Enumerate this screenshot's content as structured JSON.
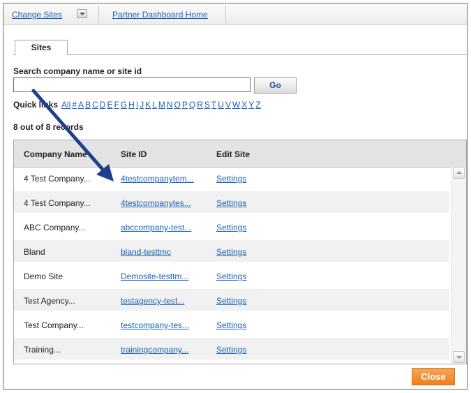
{
  "topbar": {
    "change_sites": "Change Sites",
    "partner_home": "Partner Dashboard Home"
  },
  "tab": {
    "label": "Sites"
  },
  "search": {
    "label": "Search company name or site id",
    "value": "",
    "go_label": "Go"
  },
  "quicklinks": {
    "label": "Quick links",
    "letters": [
      "All",
      "#",
      "A",
      "B",
      "C",
      "D",
      "E",
      "F",
      "G",
      "H",
      "I",
      "J",
      "K",
      "L",
      "M",
      "N",
      "O",
      "P",
      "Q",
      "R",
      "S",
      "T",
      "U",
      "V",
      "W",
      "X",
      "Y",
      "Z"
    ]
  },
  "records": {
    "text": "8 out of 8 records"
  },
  "table": {
    "headers": [
      "Company Name",
      "Site ID",
      "Edit Site"
    ],
    "rows": [
      {
        "company": "4 Test Company...",
        "site": "4testcompanytem...",
        "edit": "Settings"
      },
      {
        "company": "4 Test Company...",
        "site": "4testcompanytes...",
        "edit": "Settings"
      },
      {
        "company": "ABC Company...",
        "site": "abccompany-test...",
        "edit": "Settings"
      },
      {
        "company": "Bland",
        "site": "bland-testtmc",
        "edit": "Settings"
      },
      {
        "company": "Demo Site",
        "site": "Demosite-testtm...",
        "edit": "Settings"
      },
      {
        "company": "Test Agency...",
        "site": "testagency-test...",
        "edit": "Settings"
      },
      {
        "company": "Test Company...",
        "site": "testcompany-tes...",
        "edit": "Settings"
      },
      {
        "company": "Training...",
        "site": "trainingcompany...",
        "edit": "Settings"
      }
    ]
  },
  "footer": {
    "close_label": "Close"
  },
  "colors": {
    "link": "#1a5fb4",
    "close": "#ef8a2a",
    "arrow": "#1f3f8c"
  }
}
